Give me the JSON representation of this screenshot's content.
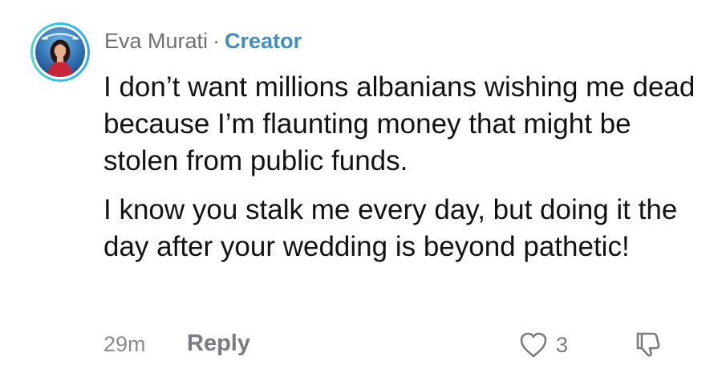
{
  "comment": {
    "author": "Eva Murati",
    "separator": "·",
    "badge": "Creator",
    "paragraphs": [
      "I don’t want millions albanians wishing me dead because I’m flaunting money that might be stolen from public funds.",
      "I know you stalk me every day, but doing it the day after your wedding is beyond pathetic!"
    ],
    "timestamp": "29m",
    "reply_label": "Reply",
    "like_count": "3"
  },
  "icons": {
    "like": "heart-outline-icon",
    "dislike": "thumbs-down-icon"
  },
  "colors": {
    "author": "#6f7075",
    "badge": "#3f8fc0",
    "text": "#121212",
    "muted": "#8a8b91",
    "avatar_ring": "#2ec4e8"
  }
}
